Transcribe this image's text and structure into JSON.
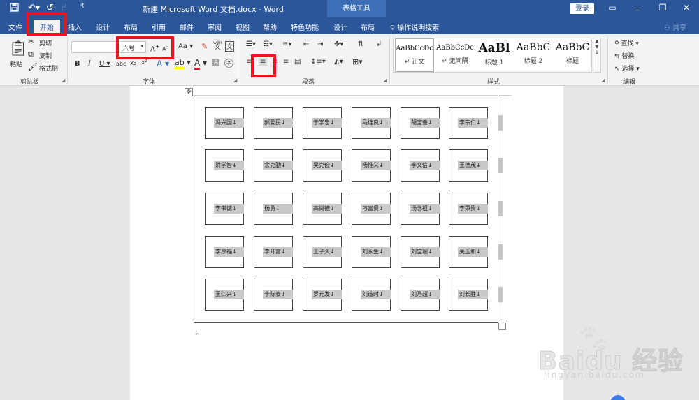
{
  "titlebar": {
    "title": "新建 Microsoft Word 文档.docx - Word",
    "context_tools": "表格工具",
    "login": "登录",
    "icons": [
      "save-icon",
      "undo-icon",
      "redo-icon",
      "touch-mode-icon",
      "customize-qat-icon"
    ]
  },
  "tabs": [
    {
      "label": "文件"
    },
    {
      "label": "开始"
    },
    {
      "label": "插入"
    },
    {
      "label": "设计"
    },
    {
      "label": "布局"
    },
    {
      "label": "引用"
    },
    {
      "label": "邮件"
    },
    {
      "label": "审阅"
    },
    {
      "label": "视图"
    },
    {
      "label": "帮助"
    },
    {
      "label": "特色功能"
    },
    {
      "label": "设计"
    },
    {
      "label": "布局"
    }
  ],
  "tell_me": "操作说明搜索",
  "share": "共享",
  "clipboard": {
    "paste": "粘贴",
    "cut": "剪切",
    "copy": "复制",
    "format_painter": "格式刷",
    "label": "剪贴板"
  },
  "font": {
    "font_name": "",
    "font_size": "六号",
    "label": "字体",
    "aa": "Aa",
    "wen": "wén",
    "wen_char": "文",
    "grow": "A",
    "shrink": "A"
  },
  "paragraph": {
    "label": "段落"
  },
  "styles": {
    "label": "样式",
    "items": [
      {
        "preview": "AaBbCcDc",
        "name": "↵ 正文"
      },
      {
        "preview": "AaBbCcDc",
        "name": "↵ 无间隔"
      },
      {
        "preview": "AaBl",
        "name": "标题 1"
      },
      {
        "preview": "AaBbC",
        "name": "标题 2"
      },
      {
        "preview": "AaBbC",
        "name": "标题"
      }
    ]
  },
  "editing": {
    "find": "查找",
    "replace": "替换",
    "select": "选择",
    "label": "编辑"
  },
  "table": {
    "rows": [
      [
        "冯兴国↓",
        "郝爱民↓",
        "于学忠↓",
        "马连良↓",
        "胡宝善↓",
        "李宗仁↓"
      ],
      [
        "洪学智↓",
        "余克勤↓",
        "吴克俭↓",
        "杨惟义↓",
        "李文信↓",
        "王德茂↓"
      ],
      [
        "李书诚↓",
        "杨勇↓",
        "高尚德↓",
        "刁富贵↓",
        "汤念祖↓",
        "李秉贵↓"
      ],
      [
        "李厚福↓",
        "李开富↓",
        "王子久↓",
        "刘永生↓",
        "刘宝瑞↓",
        "关玉和↓"
      ],
      [
        "王仁兴↓",
        "李际泰↓",
        "罗元发↓",
        "刘造时↓",
        "刘乃超↓",
        "刘长胜↓"
      ]
    ]
  },
  "watermark": {
    "brand": "Baidu",
    "cn": "经验",
    "url": "jingyan.baidu.com"
  }
}
